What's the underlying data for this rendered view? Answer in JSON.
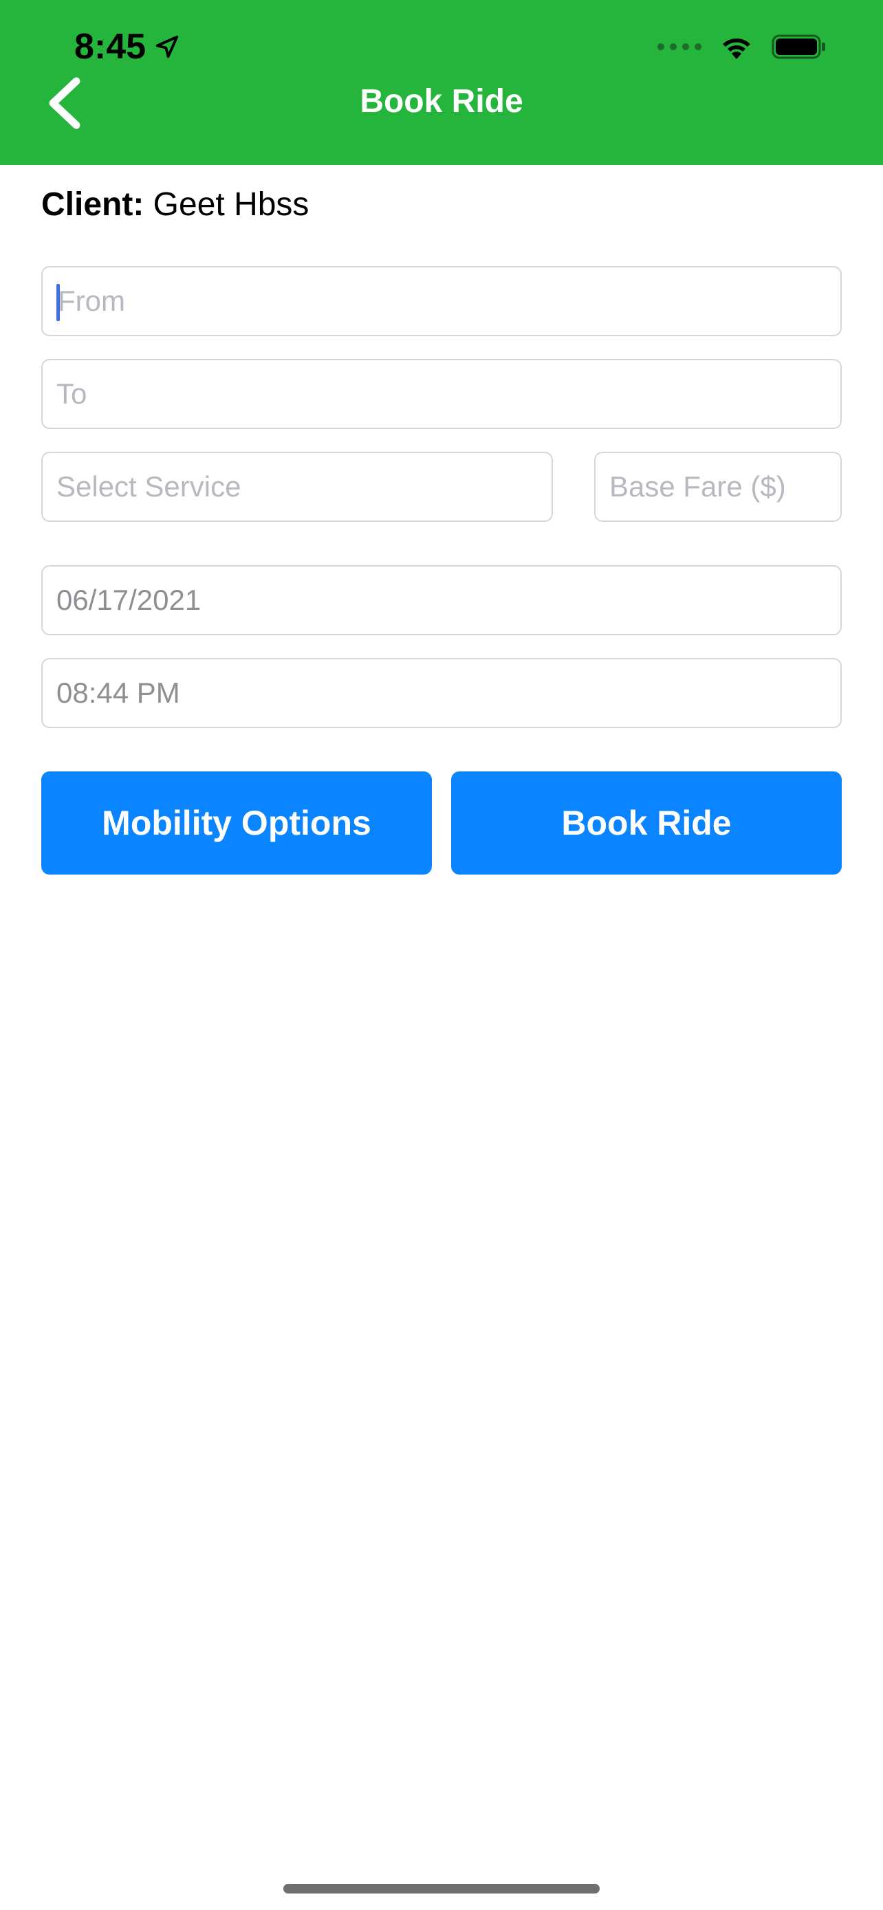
{
  "status_bar": {
    "time": "8:45"
  },
  "nav": {
    "title": "Book Ride"
  },
  "client": {
    "label": "Client:",
    "name": "Geet Hbss"
  },
  "form": {
    "from_placeholder": "From",
    "to_placeholder": "To",
    "service_placeholder": "Select Service",
    "fare_placeholder": "Base Fare ($)",
    "date_value": "06/17/2021",
    "time_value": "08:44 PM"
  },
  "buttons": {
    "mobility_label": "Mobility Options",
    "book_label": "Book Ride"
  },
  "colors": {
    "header_bg": "#25b43c",
    "button_bg": "#0a84ff",
    "cursor": "#3f6ee8"
  }
}
